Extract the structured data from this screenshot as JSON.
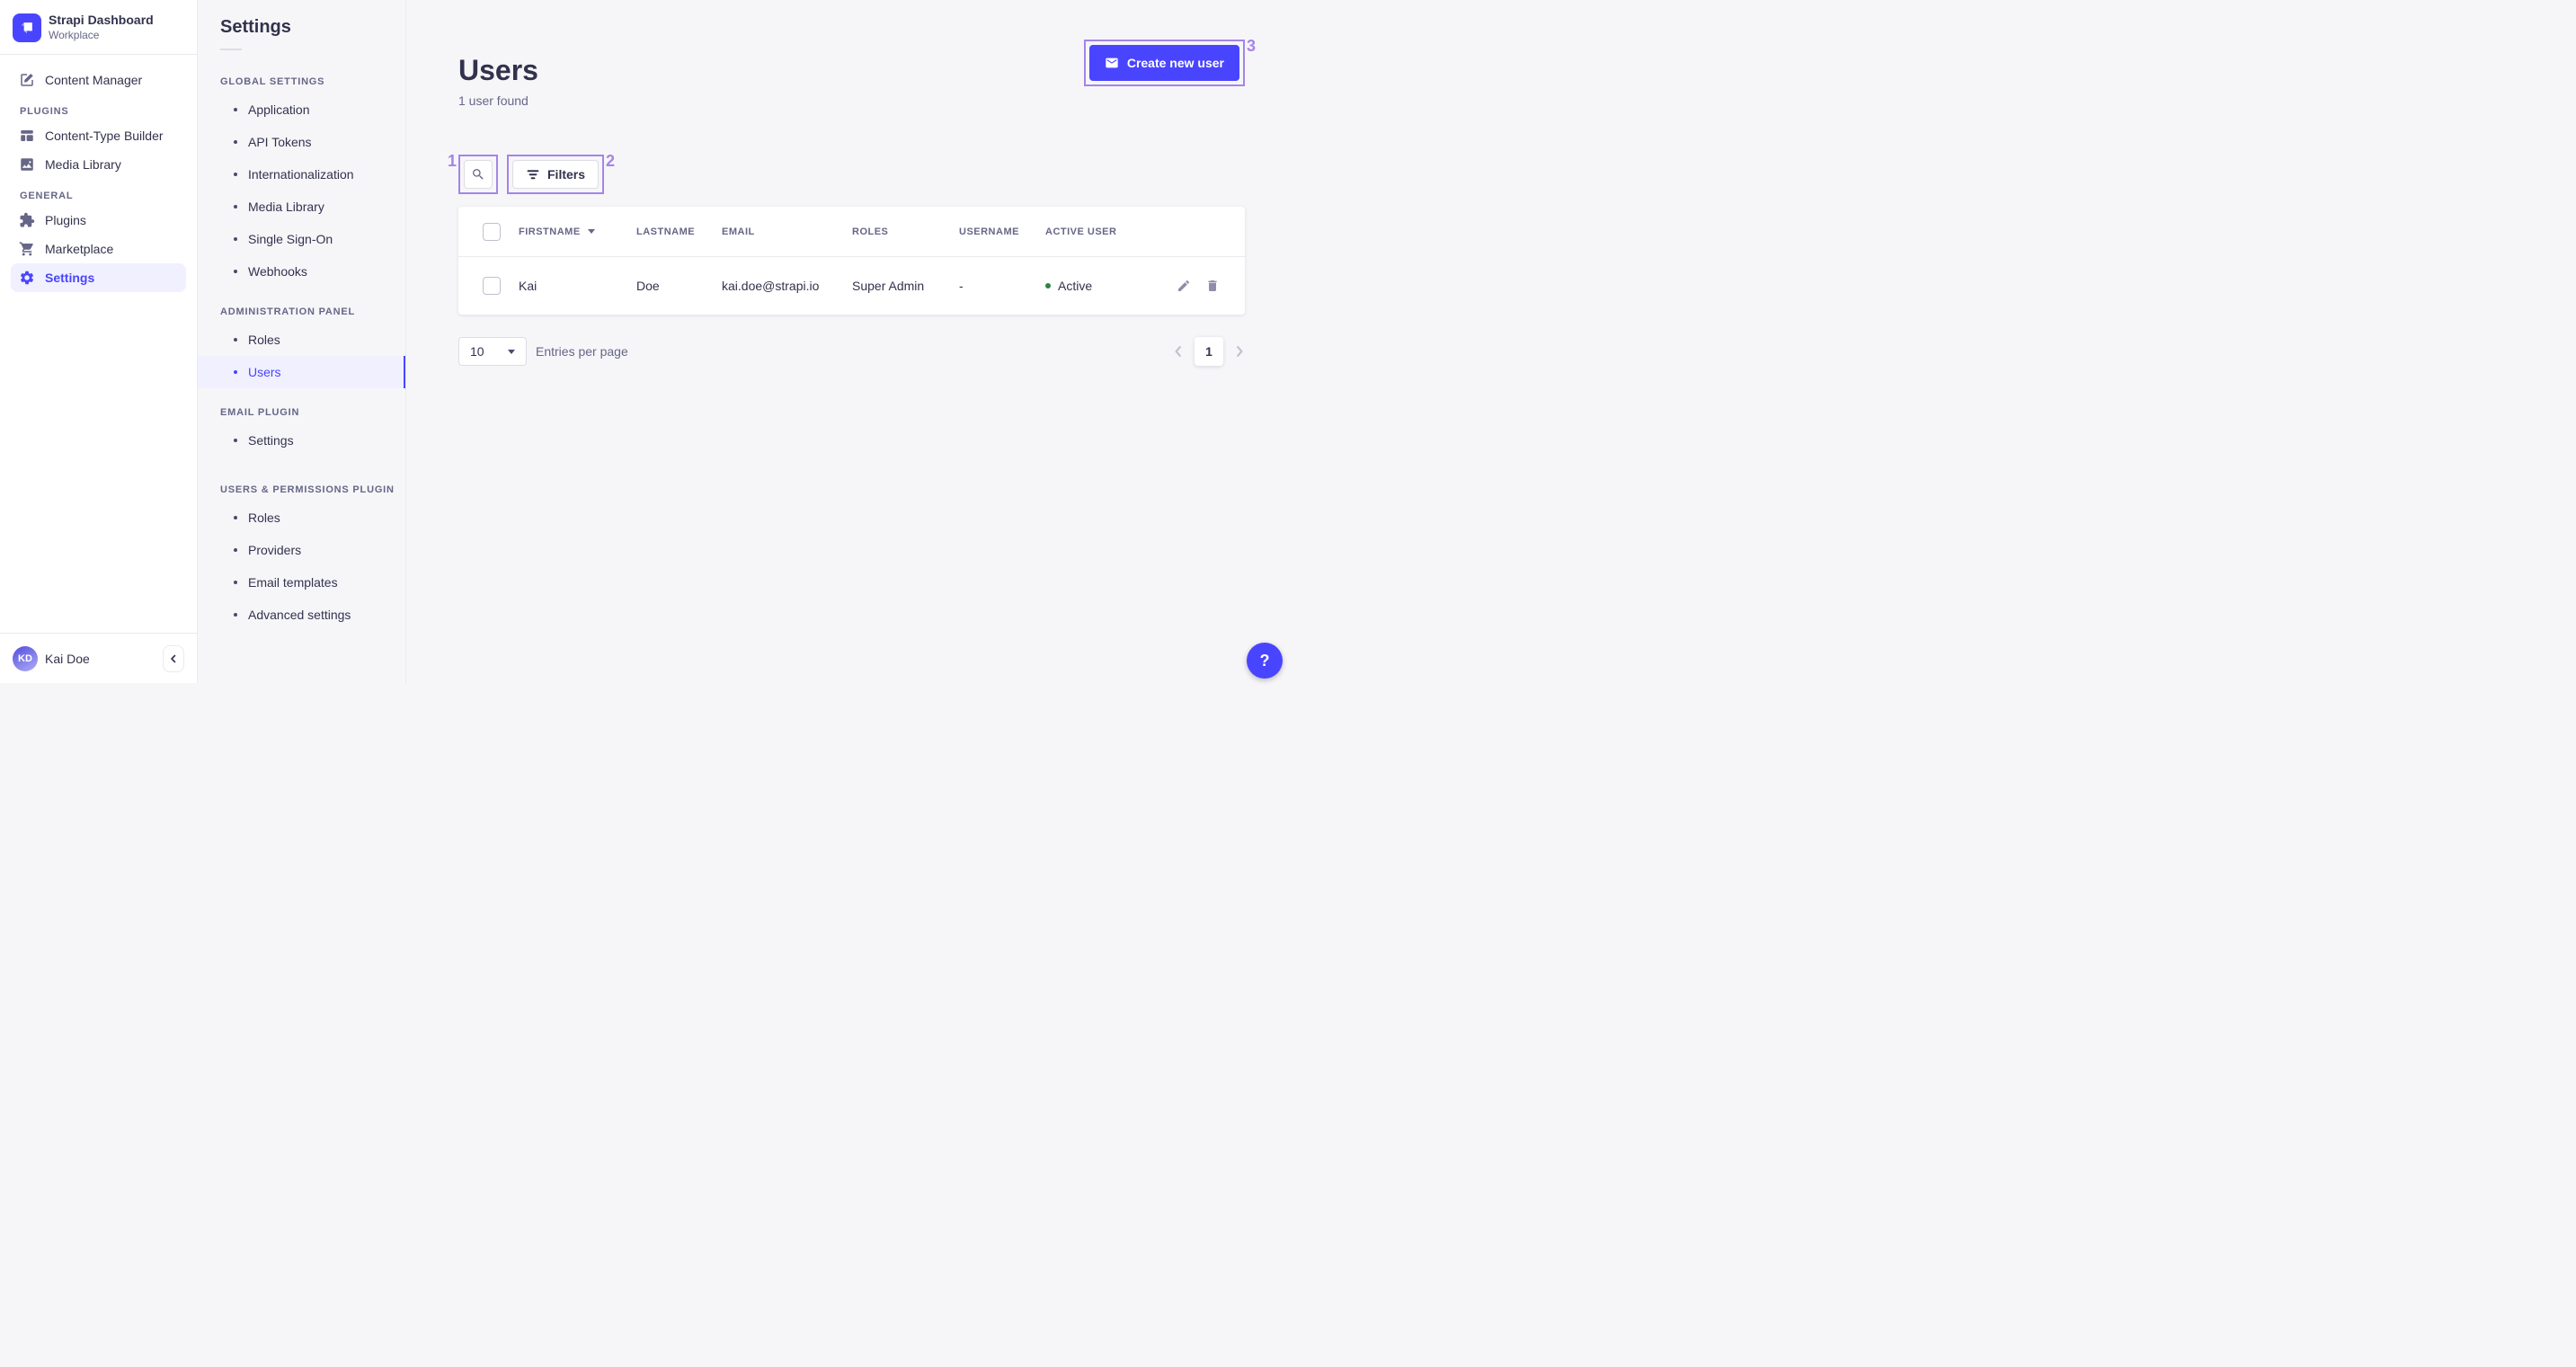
{
  "app": {
    "title": "Strapi Dashboard",
    "workspace": "Workplace"
  },
  "sidebar": {
    "content_manager": "Content Manager",
    "sections": [
      {
        "label": "PLUGINS",
        "items": [
          "Content-Type Builder",
          "Media Library"
        ]
      },
      {
        "label": "GENERAL",
        "items": [
          "Plugins",
          "Marketplace",
          "Settings"
        ]
      }
    ],
    "user": {
      "initials": "KD",
      "name": "Kai Doe"
    }
  },
  "subnav": {
    "title": "Settings",
    "sections": [
      {
        "label": "GLOBAL SETTINGS",
        "items": [
          "Application",
          "API Tokens",
          "Internationalization",
          "Media Library",
          "Single Sign-On",
          "Webhooks"
        ]
      },
      {
        "label": "ADMINISTRATION PANEL",
        "items": [
          "Roles",
          "Users"
        ]
      },
      {
        "label": "EMAIL PLUGIN",
        "items": [
          "Settings"
        ]
      },
      {
        "label": "USERS & PERMISSIONS PLUGIN",
        "items": [
          "Roles",
          "Providers",
          "Email templates",
          "Advanced settings"
        ]
      }
    ],
    "active_item": "Users"
  },
  "header": {
    "title": "Users",
    "subtitle": "1 user found",
    "create_button": "Create new user"
  },
  "toolbar": {
    "filters_button": "Filters"
  },
  "table": {
    "headers": {
      "firstname": "FIRSTNAME",
      "lastname": "LASTNAME",
      "email": "EMAIL",
      "roles": "ROLES",
      "username": "USERNAME",
      "active": "ACTIVE USER"
    },
    "rows": [
      {
        "firstname": "Kai",
        "lastname": "Doe",
        "email": "kai.doe@strapi.io",
        "roles": "Super Admin",
        "username": "-",
        "active_label": "Active"
      }
    ]
  },
  "pagination": {
    "page_size": "10",
    "entries_label": "Entries per page",
    "current_page": "1"
  },
  "annotations": {
    "labels": [
      "1",
      "2",
      "3"
    ]
  },
  "help": {
    "label": "?"
  },
  "colors": {
    "primary": "#4945ff",
    "primary_bg": "#f0f0ff",
    "annotation": "#a584e8",
    "success": "#328048",
    "background": "#f6f6f9"
  }
}
